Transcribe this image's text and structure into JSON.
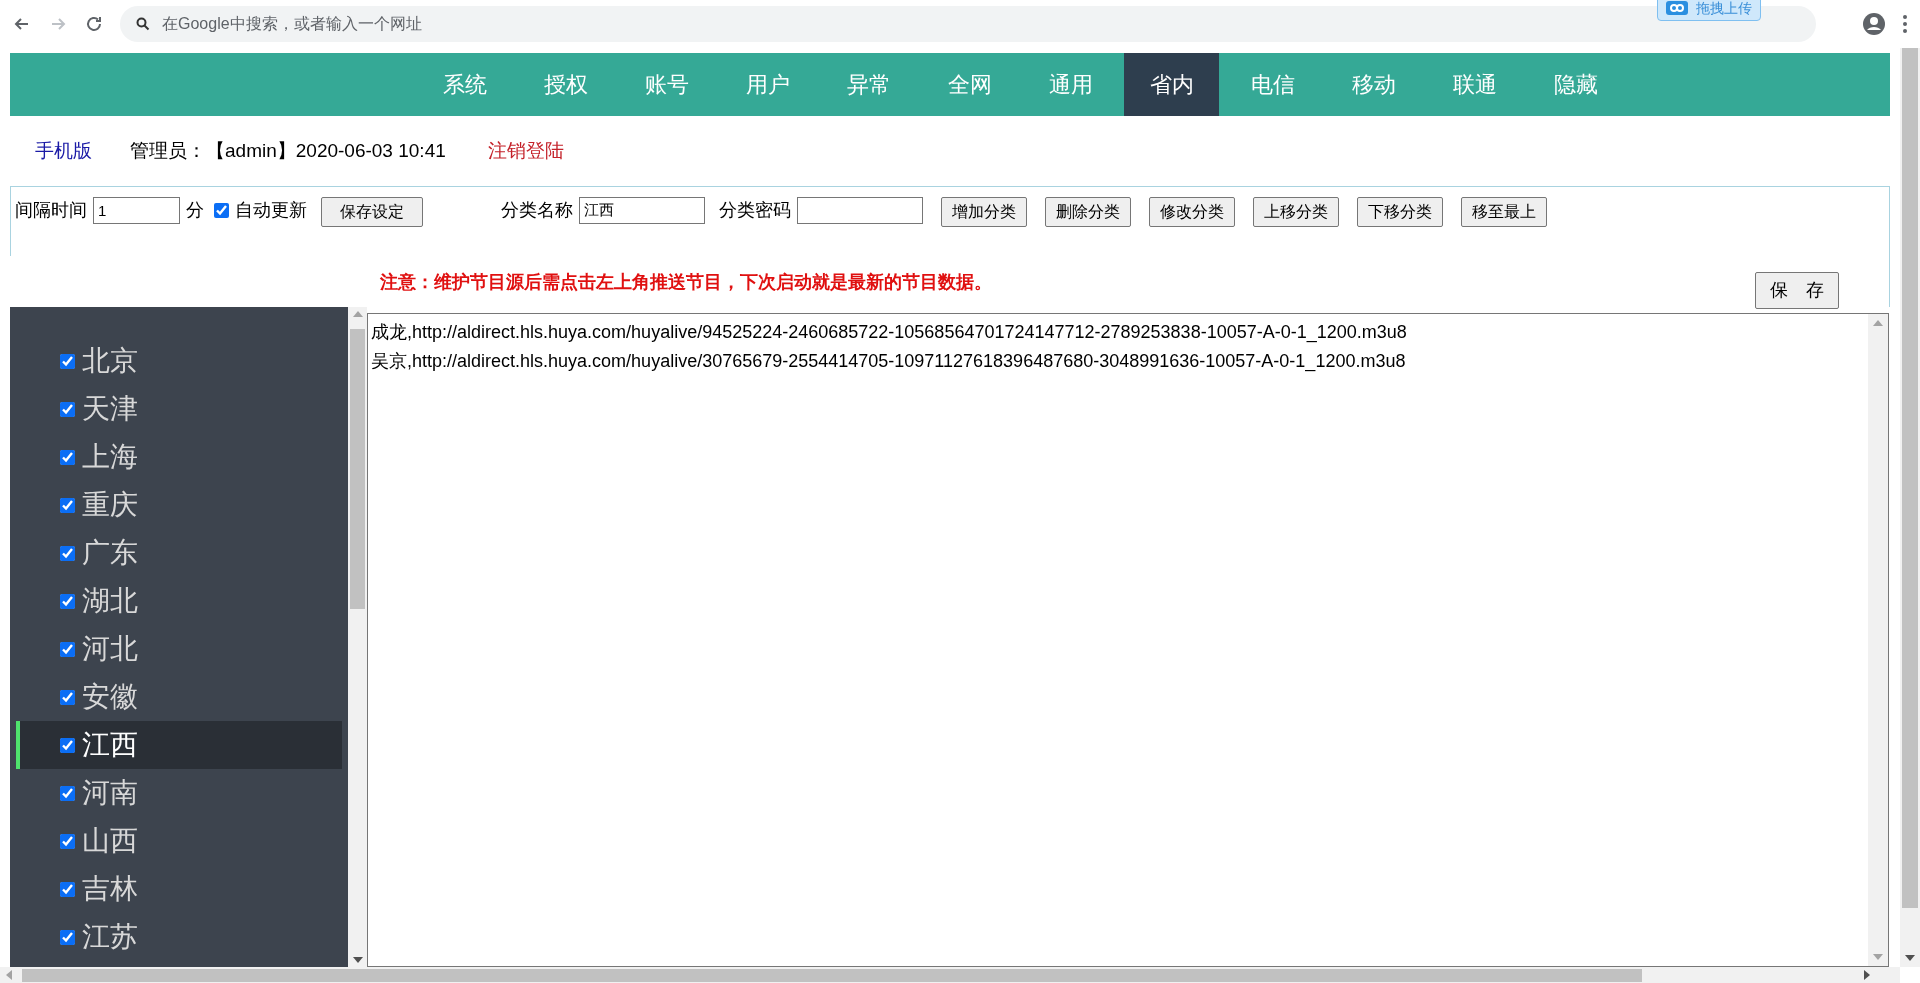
{
  "browser": {
    "address_placeholder": "在Google中搜索，或者输入一个网址",
    "extension_button": "拖拽上传"
  },
  "nav": [
    {
      "label": "系统",
      "selected": false
    },
    {
      "label": "授权",
      "selected": false
    },
    {
      "label": "账号",
      "selected": false
    },
    {
      "label": "用户",
      "selected": false
    },
    {
      "label": "异常",
      "selected": false
    },
    {
      "label": "全网",
      "selected": false
    },
    {
      "label": "通用",
      "selected": false
    },
    {
      "label": "省内",
      "selected": true
    },
    {
      "label": "电信",
      "selected": false
    },
    {
      "label": "移动",
      "selected": false
    },
    {
      "label": "联通",
      "selected": false
    },
    {
      "label": "隐藏",
      "selected": false
    }
  ],
  "header": {
    "mobile_link": "手机版",
    "admin": "管理员：【admin】2020-06-03 10:41",
    "logout": "注销登陆"
  },
  "toolbar": {
    "interval_label": "间隔时间",
    "interval_value": "1",
    "interval_unit": "分",
    "auto_update": {
      "label": "自动更新",
      "checked": true
    },
    "save_settings": "保存设定",
    "category_name_label": "分类名称",
    "category_name_value": "江西",
    "category_password_label": "分类密码",
    "buttons": [
      "增加分类",
      "删除分类",
      "修改分类",
      "上移分类",
      "下移分类",
      "移至最上"
    ]
  },
  "notice": "注意：维护节目源后需点击左上角推送节目，下次启动就是最新的节目数据。",
  "save_button": "保　存",
  "sidebar": {
    "items": [
      {
        "label": "北京",
        "checked": true,
        "selected": false
      },
      {
        "label": "天津",
        "checked": true,
        "selected": false
      },
      {
        "label": "上海",
        "checked": true,
        "selected": false
      },
      {
        "label": "重庆",
        "checked": true,
        "selected": false
      },
      {
        "label": "广东",
        "checked": true,
        "selected": false
      },
      {
        "label": "湖北",
        "checked": true,
        "selected": false
      },
      {
        "label": "河北",
        "checked": true,
        "selected": false
      },
      {
        "label": "安徽",
        "checked": true,
        "selected": false
      },
      {
        "label": "江西",
        "checked": true,
        "selected": true
      },
      {
        "label": "河南",
        "checked": true,
        "selected": false
      },
      {
        "label": "山西",
        "checked": true,
        "selected": false
      },
      {
        "label": "吉林",
        "checked": true,
        "selected": false
      },
      {
        "label": "江苏",
        "checked": true,
        "selected": false
      }
    ]
  },
  "editor": {
    "lines": [
      "成龙,http://aldirect.hls.huya.com/huyalive/94525224-2460685722-10568564701724147712-2789253838-10057-A-0-1_1200.m3u8",
      "吴京,http://aldirect.hls.huya.com/huyalive/30765679-2554414705-10971127618396487680-3048991636-10057-A-0-1_1200.m3u8"
    ]
  }
}
